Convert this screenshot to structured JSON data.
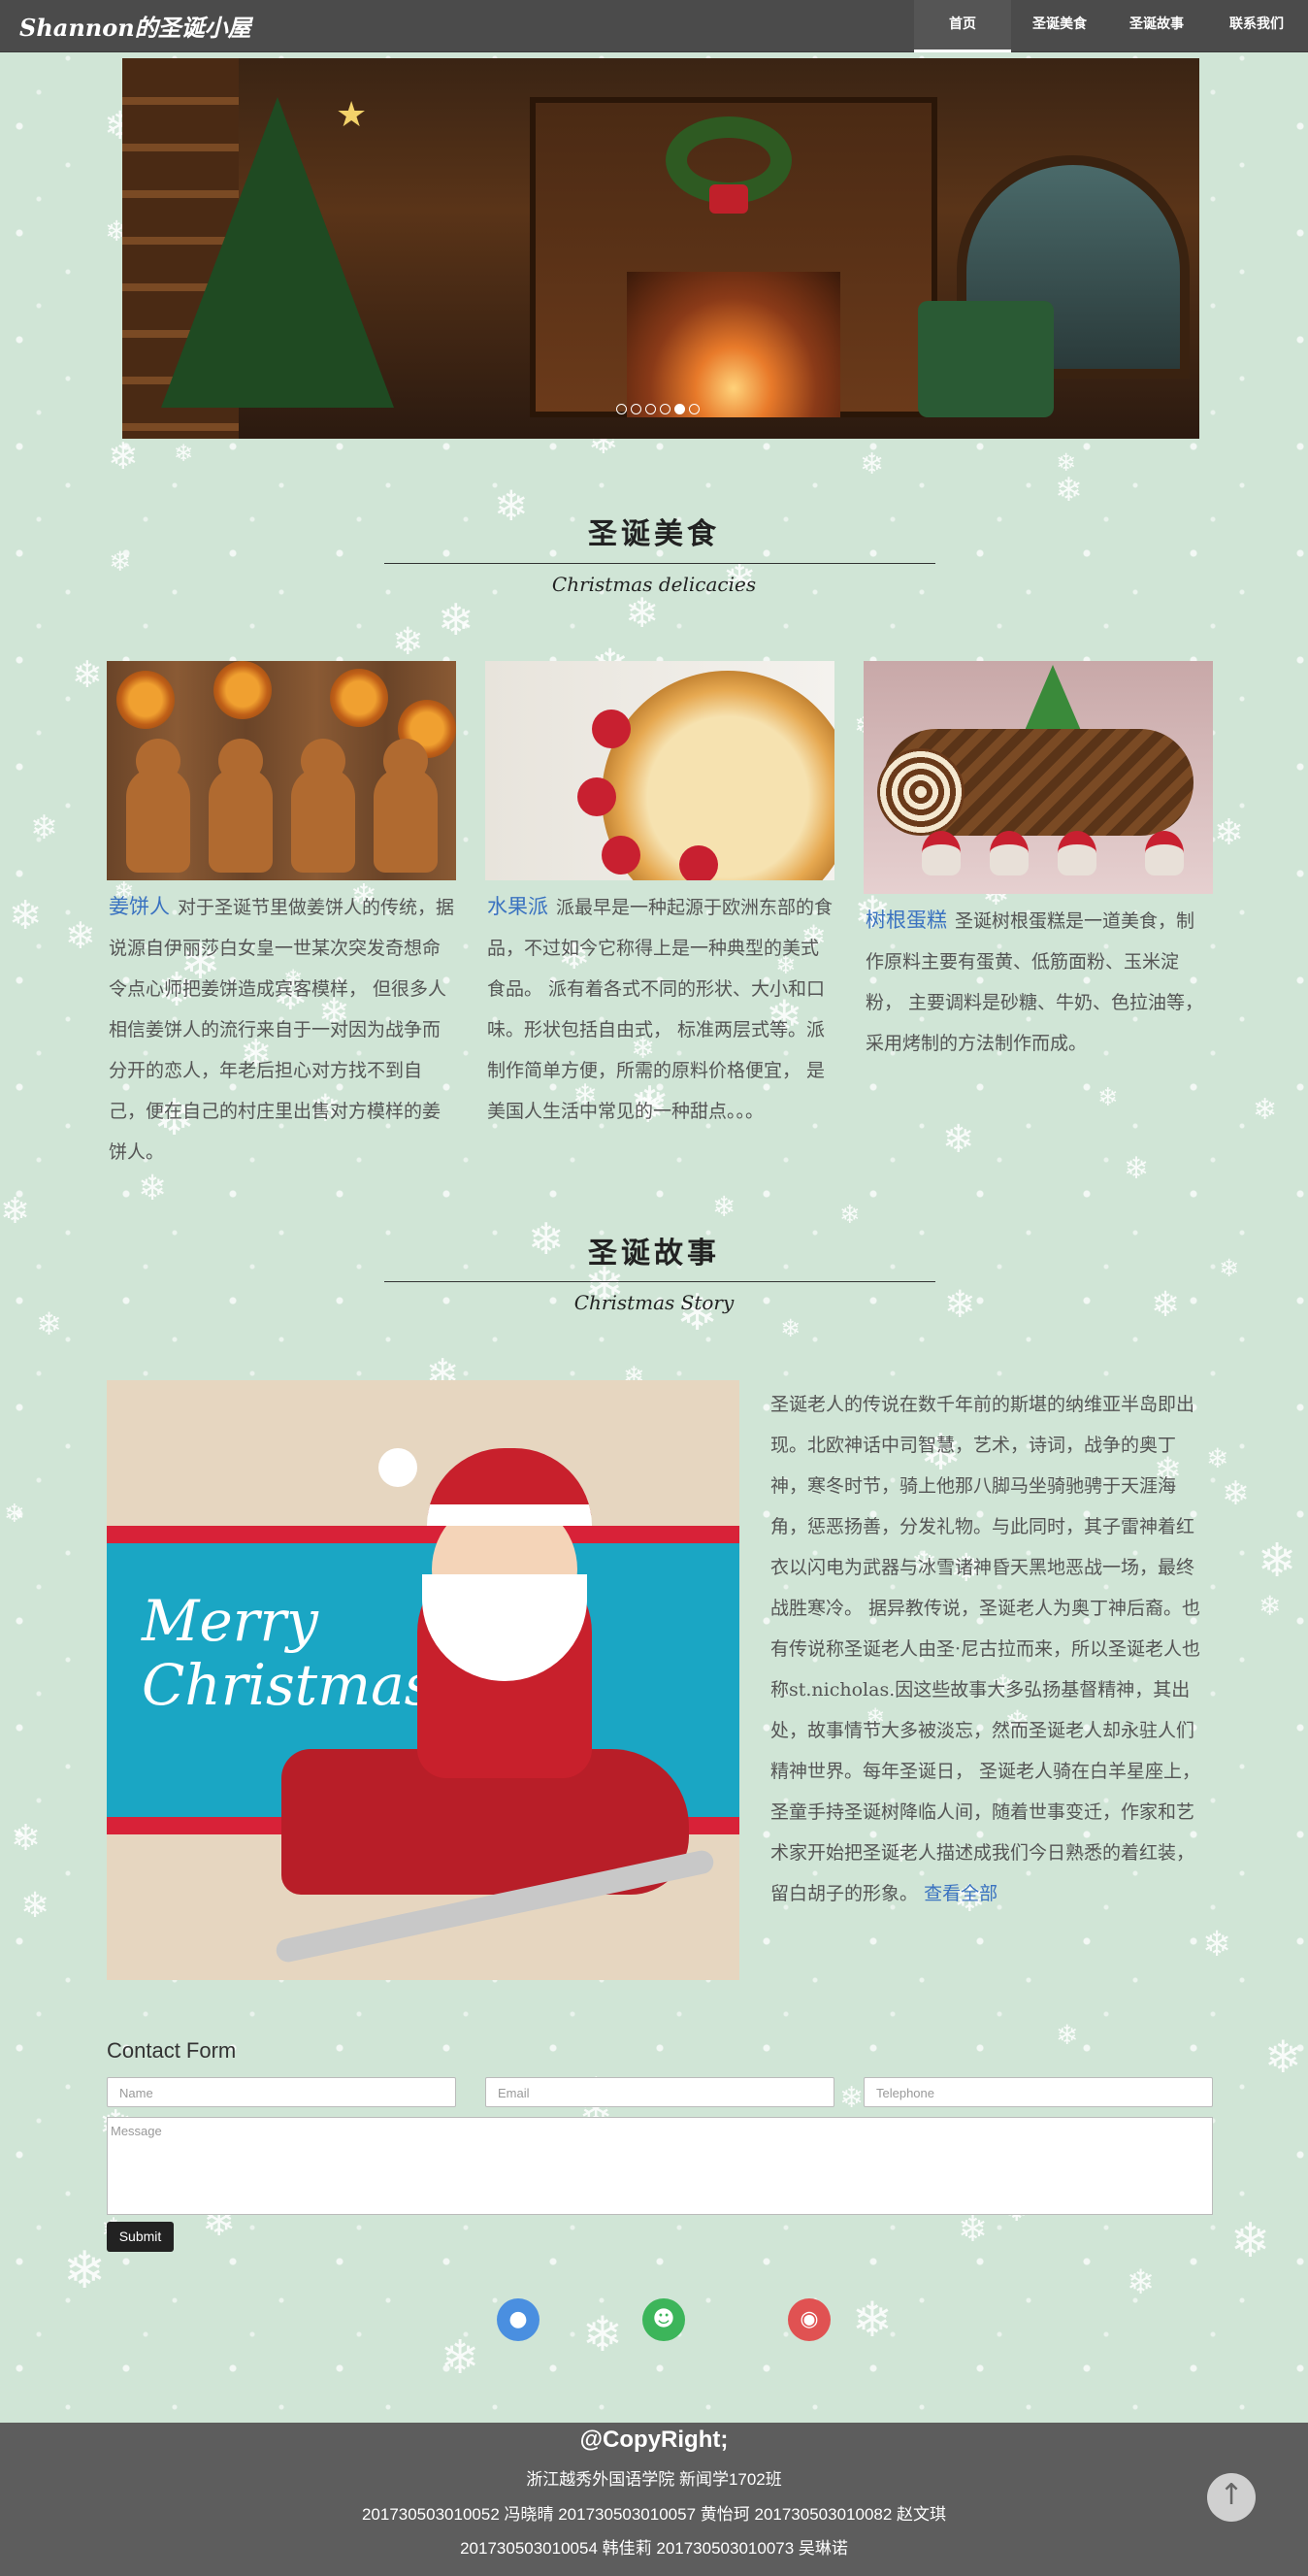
{
  "nav": {
    "brand": "Shannon的圣诞小屋",
    "items": [
      {
        "label": "首页",
        "active": true
      },
      {
        "label": "圣诞美食",
        "active": false
      },
      {
        "label": "圣诞故事",
        "active": false
      },
      {
        "label": "联系我们",
        "active": false
      }
    ]
  },
  "carousel": {
    "slide_count": 6,
    "active_index": 4
  },
  "food": {
    "title": "圣诞美食",
    "subtitle": "Christmas delicacies",
    "cards": [
      {
        "link": "姜饼人",
        "text": "对于圣诞节里做姜饼人的传统，据说源自伊丽莎白女皇一世某次突发奇想命令点心师把姜饼造成宾客模样， 但很多人相信姜饼人的流行来自于一对因为战争而分开的恋人，年老后担心对方找不到自己，便在自己的村庄里出售对方模样的姜饼人。"
      },
      {
        "link": "水果派",
        "text": "派最早是一种起源于欧洲东部的食品，不过如今它称得上是一种典型的美式食品。 派有着各式不同的形状、大小和口味。形状包括自由式， 标准两层式等。派制作简单方便，所需的原料价格便宜， 是美国人生活中常见的一种甜点。。。"
      },
      {
        "link": "树根蛋糕",
        "text": "圣诞树根蛋糕是一道美食，制作原料主要有蛋黄、低筋面粉、玉米淀粉， 主要调料是砂糖、牛奶、色拉油等，采用烤制的方法制作而成。"
      }
    ]
  },
  "story": {
    "title": "圣诞故事",
    "subtitle": "Christmas Story",
    "image_text": "Merry Christmas",
    "text": "圣诞老人的传说在数千年前的斯堪的纳维亚半岛即出现。北欧神话中司智慧，艺术，诗词，战争的奥丁神，寒冬时节，骑上他那八脚马坐骑驰骋于天涯海角，惩恶扬善，分发礼物。与此同时，其子雷神着红衣以闪电为武器与冰雪诸神昏天黑地恶战一场，最终战胜寒冷。 据异教传说，圣诞老人为奥丁神后裔。也有传说称圣诞老人由圣·尼古拉而来，所以圣诞老人也称st.nicholas.因这些故事大多弘扬基督精神，其出处，故事情节大多被淡忘，然而圣诞老人却永驻人们精神世界。每年圣诞日， 圣诞老人骑在白羊星座上，圣童手持圣诞树降临人间，随着世事变迁，作家和艺术家开始把圣诞老人描述成我们今日熟悉的着红装，留白胡子的形象。",
    "more": "查看全部"
  },
  "contact": {
    "title": "Contact Form",
    "name_placeholder": "Name",
    "email_placeholder": "Email",
    "phone_placeholder": "Telephone",
    "message_placeholder": "Message",
    "submit": "Submit"
  },
  "social": [
    {
      "icon": "qq-icon",
      "color": "#4a8fe0"
    },
    {
      "icon": "wechat-icon",
      "color": "#3cb55a"
    },
    {
      "icon": "weibo-icon",
      "color": "#e05252"
    }
  ],
  "footer": {
    "copyright": "@CopyRight;",
    "school": "浙江越秀外国语学院 新闻学1702班",
    "members_line1": "201730503010052 冯晓晴 201730503010057 黄怡珂 201730503010082 赵文琪",
    "members_line2": "201730503010054 韩佳莉 201730503010073 吴琳诺"
  },
  "colors": {
    "nav_bg": "#4b4b4b",
    "page_bg": "#d3e6d9",
    "link": "#3a72c0",
    "footer_bg": "#5d5d5d"
  }
}
